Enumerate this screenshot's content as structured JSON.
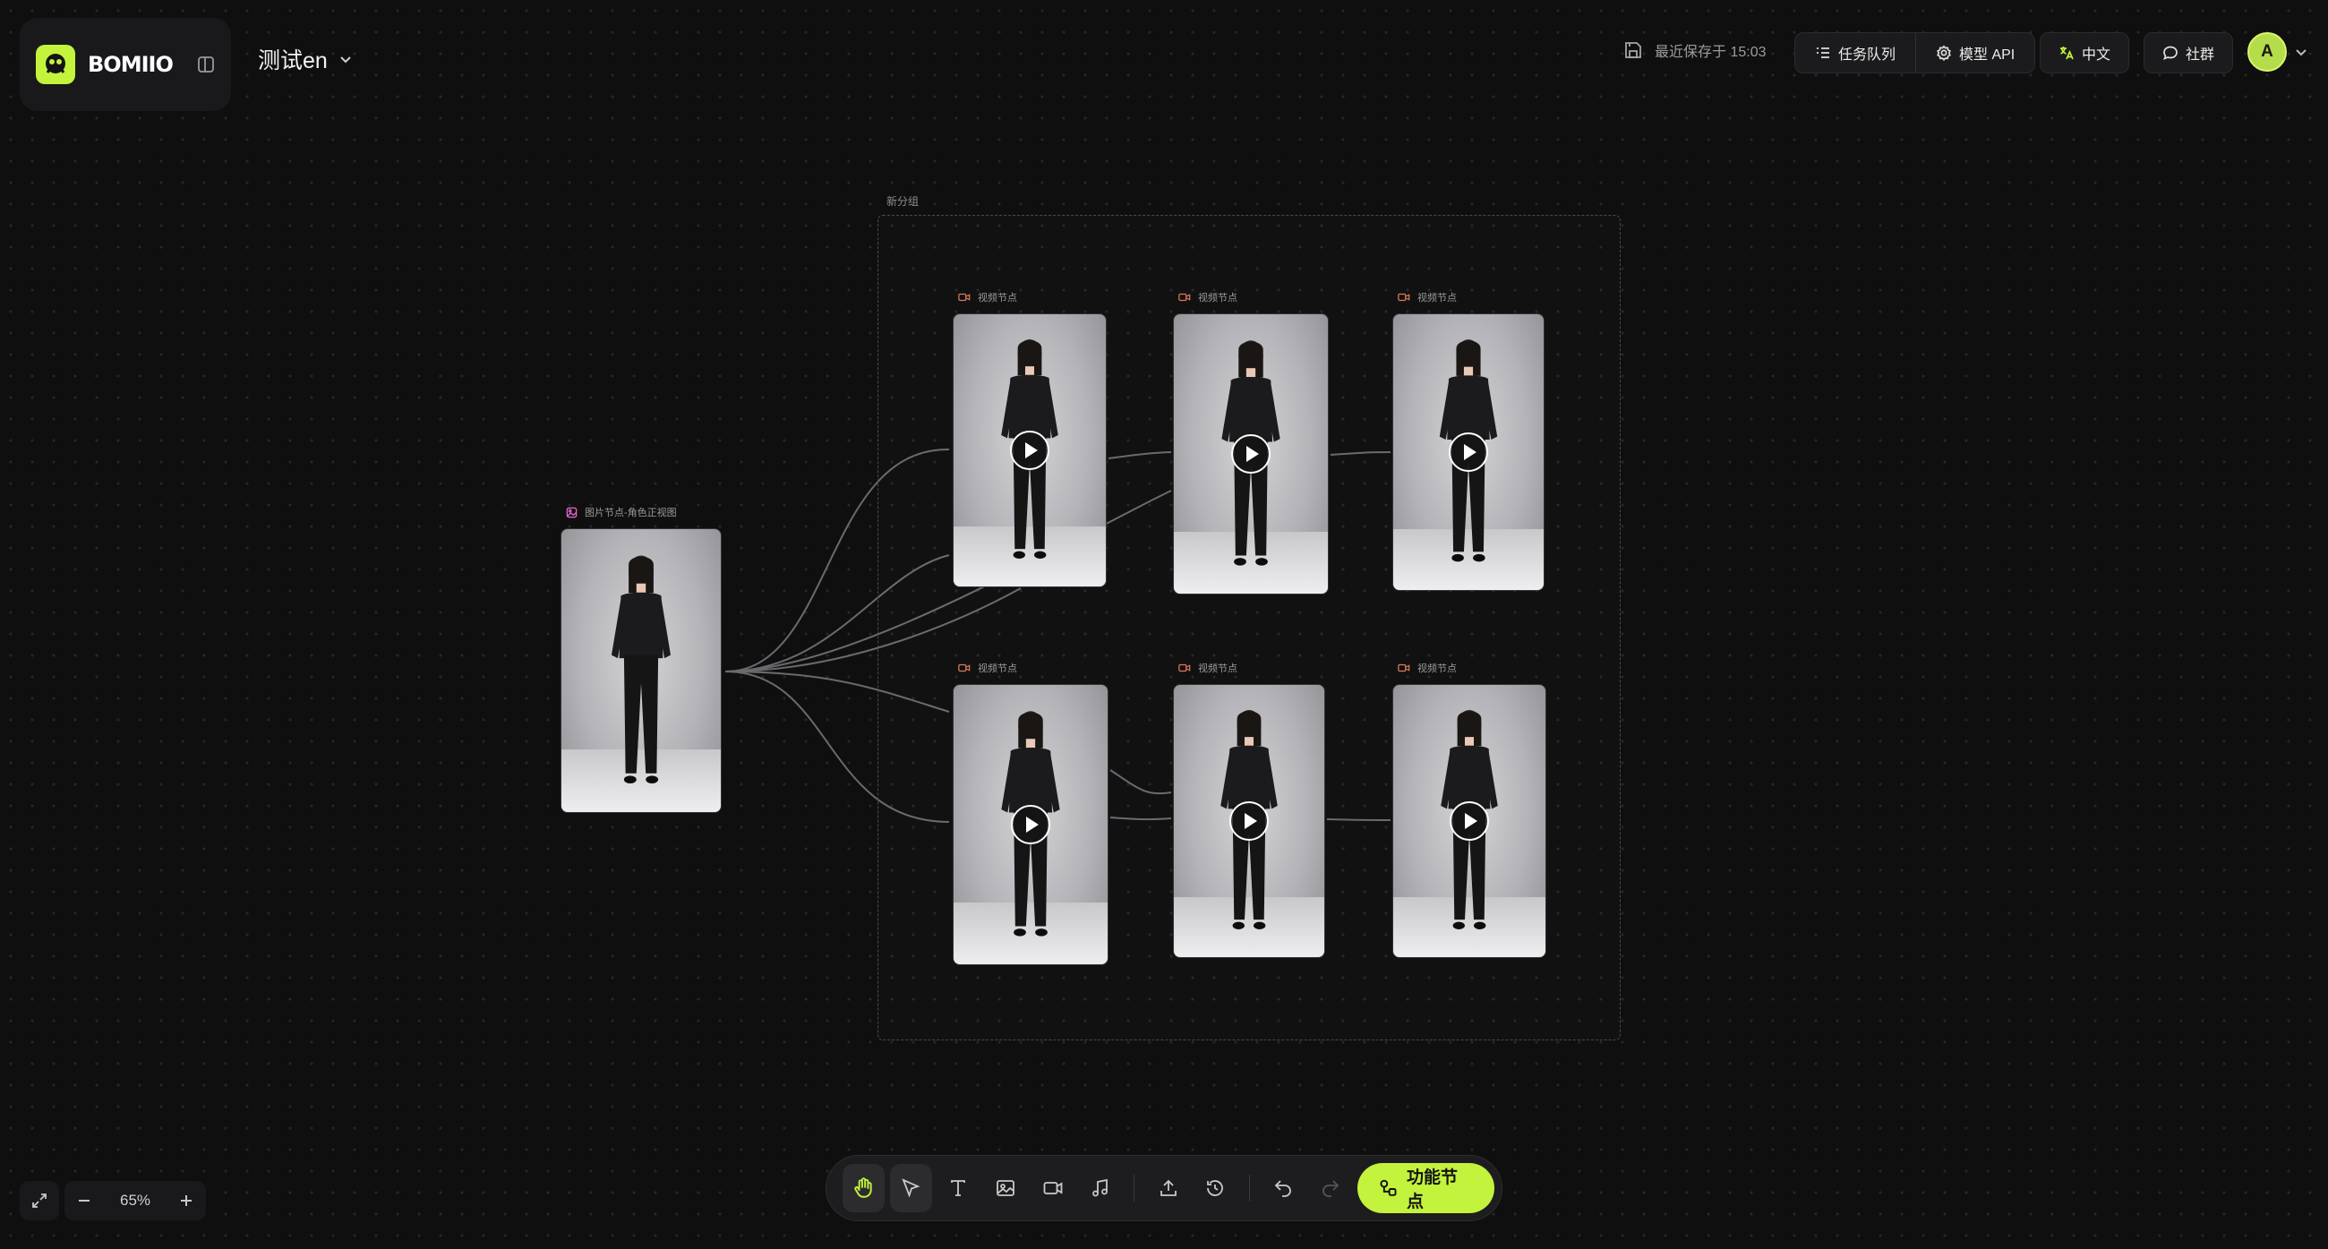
{
  "brand": {
    "name": "BOMIIO",
    "accent": "#c3f33c"
  },
  "project": {
    "title": "测试en"
  },
  "header": {
    "save_status": "最近保存于 15:03",
    "task_queue": "任务队列",
    "model_api": "模型 API",
    "language": "中文",
    "community": "社群",
    "avatar_initial": "A"
  },
  "canvas": {
    "group_label": "新分组",
    "image_node": {
      "label": "图片节点-角色正视图",
      "icon": "image-icon"
    },
    "video_nodes": [
      {
        "label": "视频节点",
        "icon": "video-icon"
      },
      {
        "label": "视频节点",
        "icon": "video-icon"
      },
      {
        "label": "视频节点",
        "icon": "video-icon"
      },
      {
        "label": "视频节点",
        "icon": "video-icon"
      },
      {
        "label": "视频节点",
        "icon": "video-icon"
      },
      {
        "label": "视频节点",
        "icon": "video-icon"
      }
    ]
  },
  "zoom": {
    "value": "65%"
  },
  "toolbar": {
    "tools": [
      "hand-icon",
      "pointer-icon",
      "text-icon",
      "image-icon",
      "video-icon",
      "audio-icon",
      "upload-icon",
      "history-icon",
      "undo-icon",
      "redo-icon"
    ],
    "feature_button": "功能节点"
  }
}
